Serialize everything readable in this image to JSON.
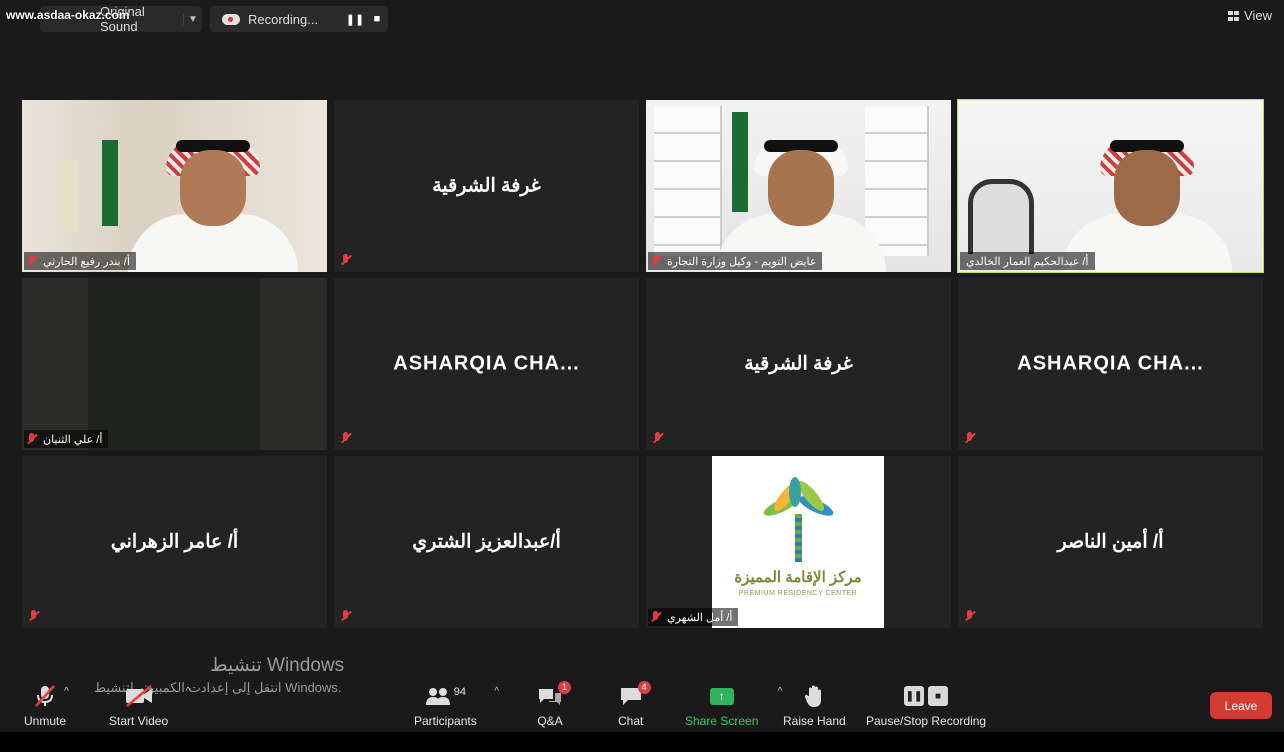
{
  "watermark": "www.asdaa-okaz.com",
  "top_bar": {
    "original_sound": "Original Sound",
    "recording": "Recording...",
    "view": "View"
  },
  "tiles": [
    {
      "type": "video",
      "name": "أ/ بندر رفيع الحارثي"
    },
    {
      "type": "name",
      "center": "غرفة الشرقية"
    },
    {
      "type": "video",
      "name": "عايض التويم - وكيل وزارة التجارة"
    },
    {
      "type": "video",
      "name": "أ/ عبدالحكيم العمار الخالدي",
      "active": true
    },
    {
      "type": "video",
      "name": "أ/ علي الثنيان"
    },
    {
      "type": "name",
      "center": "ASHARQIA  CHA..."
    },
    {
      "type": "name",
      "center": "غرفة الشرقية"
    },
    {
      "type": "name",
      "center": "ASHARQIA  CHA..."
    },
    {
      "type": "name",
      "center": "أ/ عامر الزهراني"
    },
    {
      "type": "name",
      "center": "أ/عبدالعزيز الشتري"
    },
    {
      "type": "logo",
      "name": "أ/ أمل الشهري",
      "logo_ar": "مركز الإقامة المميزة",
      "logo_en": "PREMIUM RESIDENCY CENTER"
    },
    {
      "type": "name",
      "center": "أ/ أمين الناصر"
    }
  ],
  "activation": {
    "title": "تنشيط Windows",
    "subtitle": "انتقل إلى إعدادت الكمبيوتر لتنشيط Windows."
  },
  "toolbar": {
    "unmute": "Unmute",
    "start_video": "Start Video",
    "participants": "Participants",
    "participants_count": "94",
    "qa": "Q&A",
    "qa_badge": "1",
    "chat": "Chat",
    "chat_badge": "4",
    "share_screen": "Share Screen",
    "raise_hand": "Raise Hand",
    "pause_stop_recording": "Pause/Stop Recording",
    "leave": "Leave"
  },
  "colors": {
    "active_speaker": "#b6e04a",
    "mic_muted": "#e03e3e",
    "share_green": "#2fb35c",
    "leave_red": "#d43b33"
  }
}
